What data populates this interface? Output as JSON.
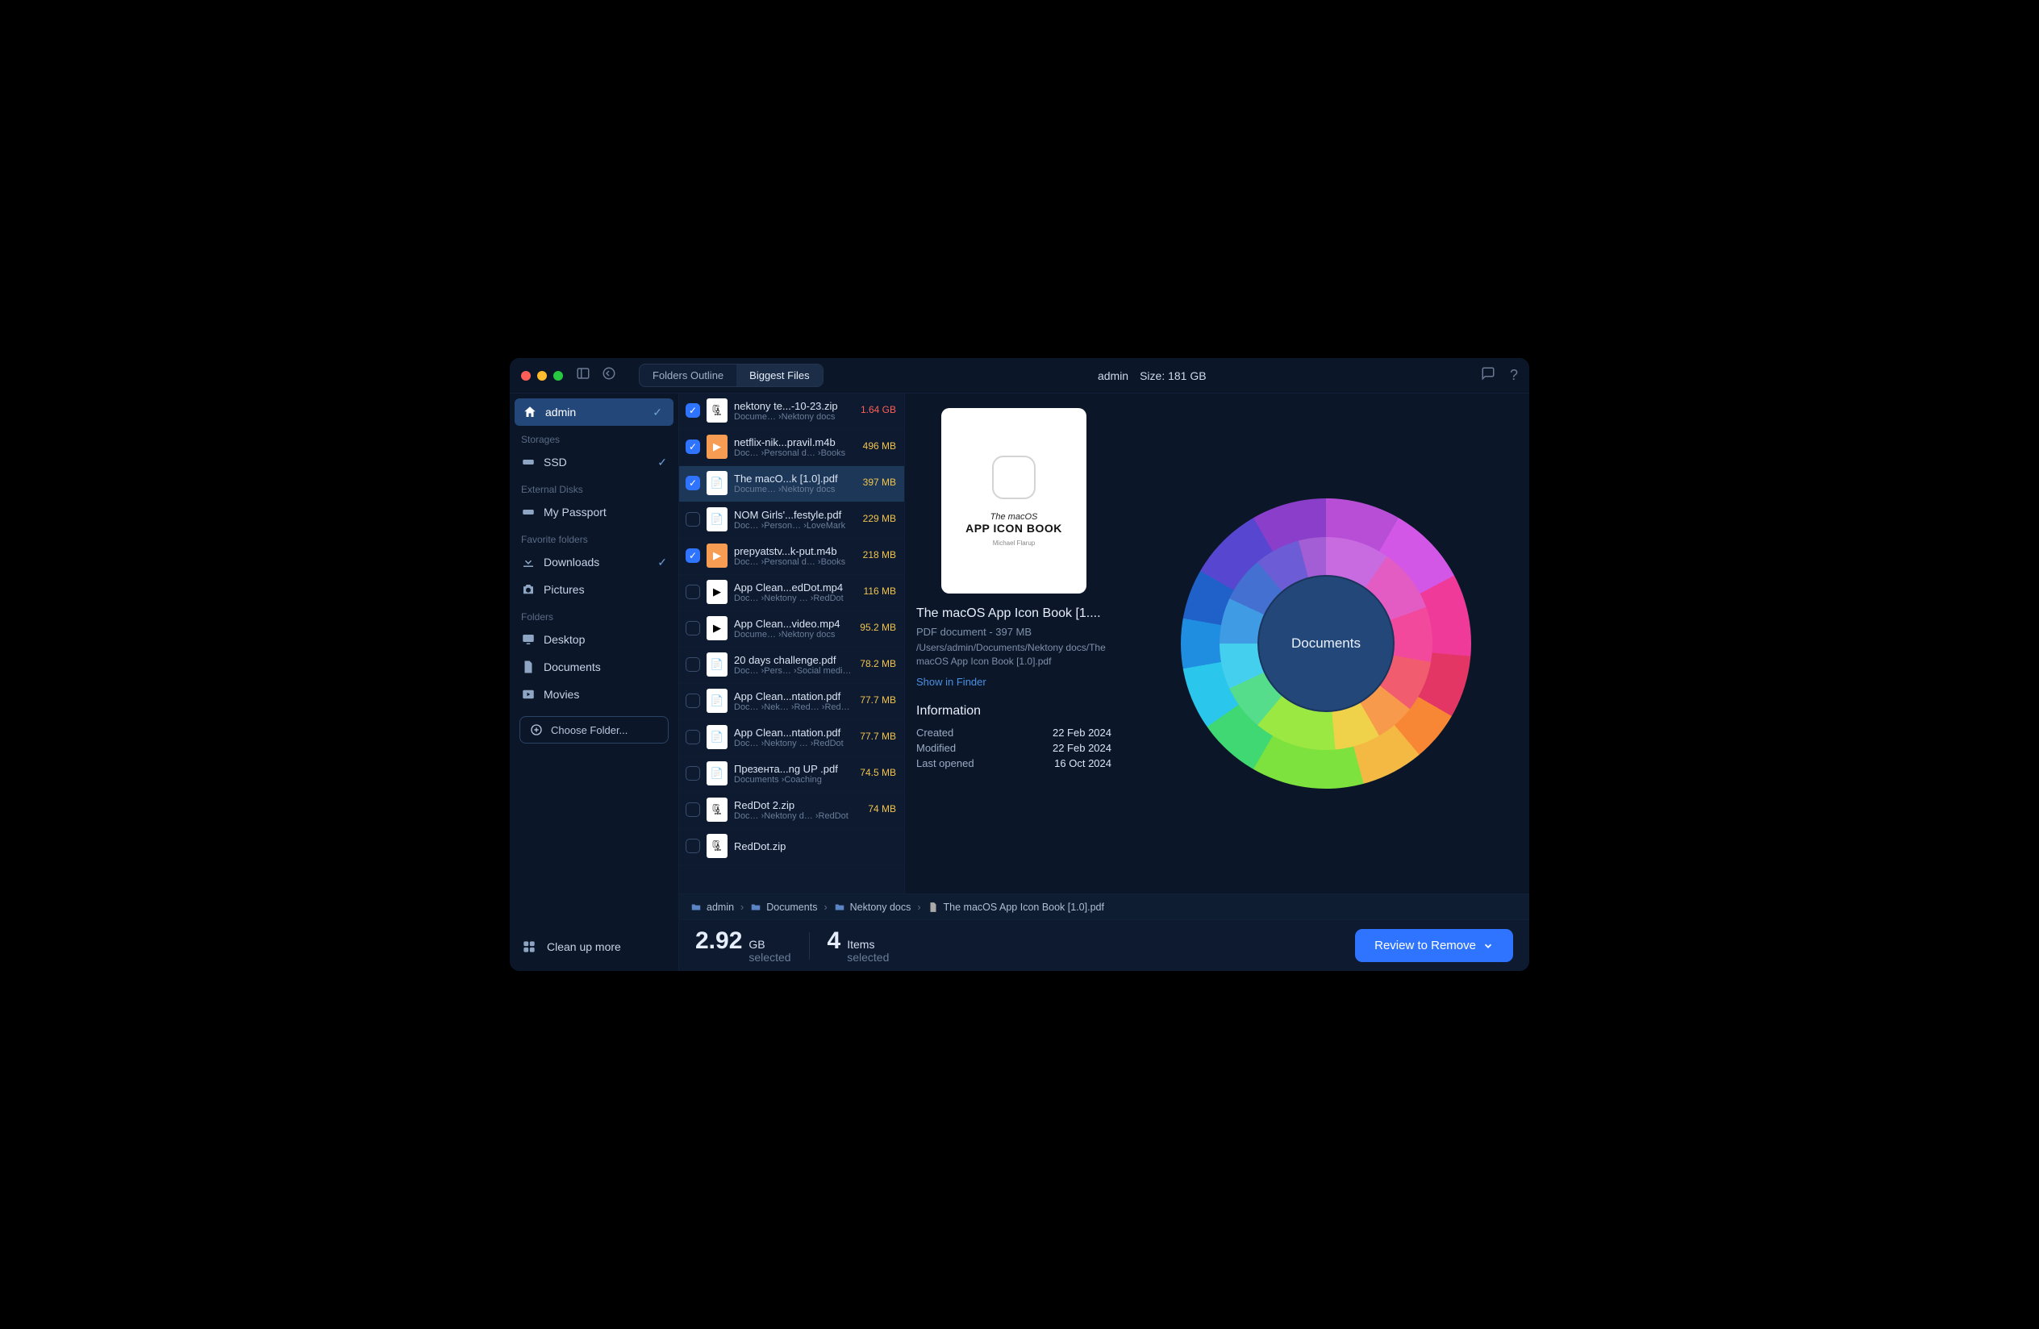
{
  "titlebar": {
    "tabs": {
      "outline": "Folders Outline",
      "biggest": "Biggest Files"
    },
    "user": "admin",
    "size_label": "Size: 181 GB"
  },
  "sidebar": {
    "admin": "admin",
    "headers": {
      "storages": "Storages",
      "external": "External Disks",
      "favorite": "Favorite folders",
      "folders": "Folders"
    },
    "items": {
      "ssd": "SSD",
      "passport": "My Passport",
      "downloads": "Downloads",
      "pictures": "Pictures",
      "desktop": "Desktop",
      "documents": "Documents",
      "movies": "Movies"
    },
    "choose": "Choose Folder...",
    "cleanup": "Clean up more"
  },
  "files": [
    {
      "name": "nektony te...-10-23.zip",
      "path": "Docume… ›Nektony docs",
      "size": "1.64 GB",
      "color": "#ff5f57",
      "icon": "zip",
      "checked": true
    },
    {
      "name": "netflix-nik...pravil.m4b",
      "path": "Doc… ›Personal d… ›Books",
      "size": "496 MB",
      "color": "#f2c44c",
      "icon": "m4b",
      "checked": true
    },
    {
      "name": "The macO...k [1.0].pdf",
      "path": "Docume… ›Nektony docs",
      "size": "397 MB",
      "color": "#f2c44c",
      "icon": "pdf",
      "checked": true,
      "selected": true
    },
    {
      "name": "NOM Girls'...festyle.pdf",
      "path": "Doc… ›Person… ›LoveMark",
      "size": "229 MB",
      "color": "#f2c44c",
      "icon": "pdf",
      "checked": false
    },
    {
      "name": "prepyatstv...k-put.m4b",
      "path": "Doc… ›Personal d… ›Books",
      "size": "218 MB",
      "color": "#f2c44c",
      "icon": "m4b",
      "checked": true
    },
    {
      "name": "App Clean...edDot.mp4",
      "path": "Doc… ›Nektony … ›RedDot",
      "size": "116 MB",
      "color": "#f2c44c",
      "icon": "mp4",
      "checked": false
    },
    {
      "name": "App Clean...video.mp4",
      "path": "Docume… ›Nektony docs",
      "size": "95.2 MB",
      "color": "#f2c44c",
      "icon": "mp4",
      "checked": false
    },
    {
      "name": "20 days challenge.pdf",
      "path": "Doc… ›Pers… ›Social media…",
      "size": "78.2 MB",
      "color": "#f2c44c",
      "icon": "pdf",
      "checked": false
    },
    {
      "name": "App Clean...ntation.pdf",
      "path": "Doc… ›Nek… ›Red… ›RedDo…",
      "size": "77.7 MB",
      "color": "#f2c44c",
      "icon": "pdf",
      "checked": false
    },
    {
      "name": "App Clean...ntation.pdf",
      "path": "Doc… ›Nektony … ›RedDot",
      "size": "77.7 MB",
      "color": "#f2c44c",
      "icon": "pdf",
      "checked": false
    },
    {
      "name": "Презента...ng UP .pdf",
      "path": "Documents ›Coaching",
      "size": "74.5 MB",
      "color": "#f2c44c",
      "icon": "pdf",
      "checked": false
    },
    {
      "name": "RedDot 2.zip",
      "path": "Doc… ›Nektony d… ›RedDot",
      "size": "74 MB",
      "color": "#f2c44c",
      "icon": "zip",
      "checked": false
    },
    {
      "name": "RedDot.zip",
      "path": "",
      "size": "",
      "color": "#f2c44c",
      "icon": "zip",
      "checked": false
    }
  ],
  "detail": {
    "preview": {
      "line1": "The macOS",
      "line2": "APP ICON BOOK",
      "author": "Michael Flarup"
    },
    "title": "The macOS App Icon Book [1....",
    "subtitle": "PDF document - 397 MB",
    "path": "/Users/admin/Documents/Nektony docs/The macOS App Icon Book [1.0].pdf",
    "show_in_finder": "Show in Finder",
    "info_header": "Information",
    "rows": {
      "created_l": "Created",
      "created_v": "22 Feb 2024",
      "modified_l": "Modified",
      "modified_v": "22 Feb 2024",
      "opened_l": "Last opened",
      "opened_v": "16 Oct 2024"
    }
  },
  "sunburst": {
    "center": "Documents"
  },
  "crumbs": {
    "c1": "admin",
    "c2": "Documents",
    "c3": "Nektony docs",
    "c4": "The macOS App Icon Book [1.0].pdf"
  },
  "footer": {
    "size_big": "2.92",
    "size_unit": "GB",
    "size_sub": "selected",
    "items_big": "4",
    "items_unit": "Items",
    "items_sub": "selected",
    "button": "Review to Remove"
  }
}
